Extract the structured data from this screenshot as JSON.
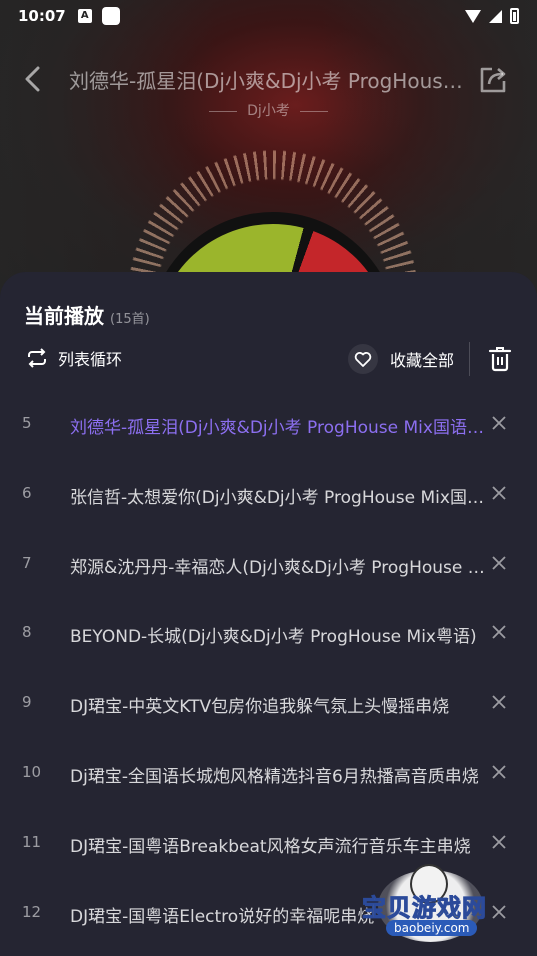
{
  "status_bar": {
    "time": "10:07",
    "notif_a": "A"
  },
  "header": {
    "song_title": "刘德华-孤星泪(Dj小爽&Dj小考 ProgHouse Mix国语女)",
    "artist": "Dj小考"
  },
  "playlist": {
    "title": "当前播放",
    "count": "(15首)",
    "loop_mode_label": "列表循环",
    "favorite_all_label": "收藏全部",
    "items": [
      {
        "num": "5",
        "name": "刘德华-孤星泪(Dj小爽&Dj小考 ProgHouse Mix国语女)",
        "active": true
      },
      {
        "num": "6",
        "name": "张信哲-太想爱你(Dj小爽&Dj小考 ProgHouse Mix国语)"
      },
      {
        "num": "7",
        "name": "郑源&沈丹丹-幸福恋人(Dj小爽&Dj小考 ProgHouse Mix)"
      },
      {
        "num": "8",
        "name": "BEYOND-长城(Dj小爽&Dj小考 ProgHouse Mix粤语)"
      },
      {
        "num": "9",
        "name": "DJ珺宝-中英文KTV包房你追我躲气氛上头慢摇串烧"
      },
      {
        "num": "10",
        "name": "Dj珺宝-全国语长城炮风格精选抖音6月热播高音质串烧"
      },
      {
        "num": "11",
        "name": "DJ珺宝-国粤语Breakbeat风格女声流行音乐车主串烧"
      },
      {
        "num": "12",
        "name": "DJ珺宝-国粤语Electro说好的幸福呢串烧"
      }
    ]
  },
  "watermark": {
    "text": "宝贝游戏网",
    "url": "baobeiy.com"
  },
  "colors": {
    "active_accent": "#8c6ff0",
    "sheet_bg": "#252532"
  }
}
